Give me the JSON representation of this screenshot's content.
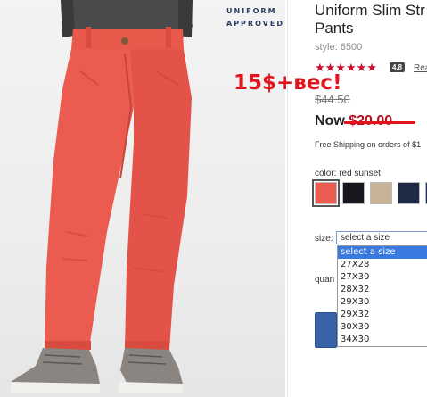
{
  "brand": {
    "badge_line1": "UNIFORM",
    "badge_line2": "APPROVED"
  },
  "product": {
    "title_line1": "Uniform Slim Str",
    "title_line2": "Pants",
    "style": "style: 6500",
    "stars": "★★★★★★",
    "rating": "4.8",
    "reviews_link": "Rea",
    "old_price": "$44.50",
    "now_label": "Now ",
    "now_amount": "$20.00",
    "shipping": "Free Shipping on orders of $1"
  },
  "overlay_note": "15$+вес!",
  "color": {
    "label": "color: red sunset",
    "swatches": [
      "red-sunset",
      "black",
      "khaki",
      "navy",
      "dark-navy"
    ],
    "swatch_colors": [
      "#ec5b4f",
      "#16181d",
      "#c9b397",
      "#1f2a44",
      "#1d2d4d"
    ]
  },
  "size": {
    "label": "size:",
    "selected": "select a size",
    "options": [
      "select a size",
      "27X28",
      "27X30",
      "28X32",
      "29X30",
      "29X32",
      "30X30",
      "34X30"
    ]
  },
  "quantity": {
    "label": "quan"
  },
  "colors": {
    "accent": "#c8102e",
    "pants": "#ec5b4f",
    "overlay": "#e2141d"
  }
}
